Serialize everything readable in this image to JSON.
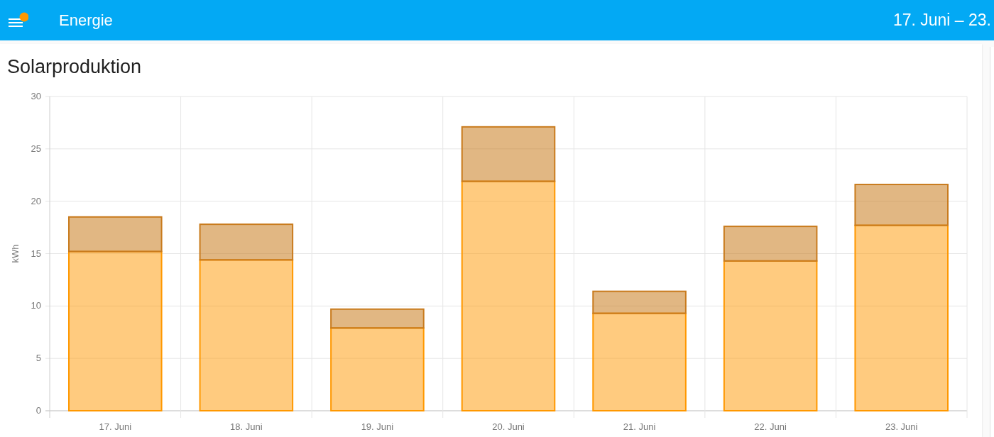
{
  "header": {
    "title": "Energie",
    "date_range": "17. Juni – 23."
  },
  "card": {
    "title": "Solarproduktion",
    "chart_data": {
      "type": "bar",
      "stacked": true,
      "ylabel": "kWh",
      "categories": [
        "17. Juni",
        "18. Juni",
        "19. Juni",
        "20. Juni",
        "21. Juni",
        "22. Juni",
        "23. Juni"
      ],
      "series": [
        {
          "color": "#ff9800",
          "values": [
            15.2,
            14.4,
            7.9,
            21.9,
            9.3,
            14.3,
            17.7
          ]
        },
        {
          "color": "#c97b1d",
          "values": [
            3.3,
            3.4,
            1.8,
            5.2,
            2.1,
            3.3,
            3.9
          ]
        }
      ],
      "grid": true,
      "ylim": [
        0,
        30
      ],
      "yticks": [
        0,
        5,
        10,
        15,
        20,
        25,
        30
      ]
    }
  }
}
